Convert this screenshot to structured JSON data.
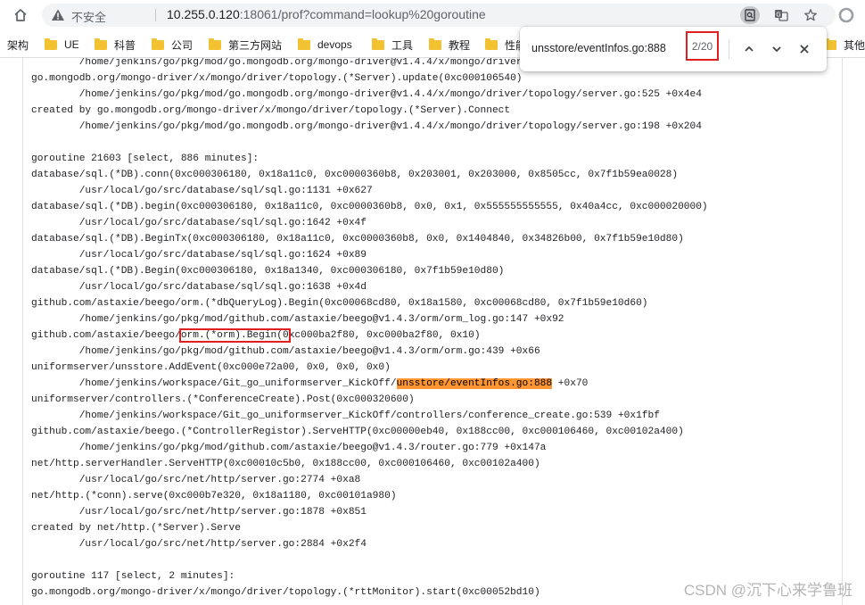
{
  "browser": {
    "insecure_label": "不安全",
    "url_host": "10.255.0.120",
    "url_rest": ":18061/prof?command=lookup%20goroutine",
    "icons": [
      "home-icon",
      "warning-icon",
      "find-in-page-icon",
      "translate-icon",
      "star-icon",
      "profile-icon"
    ]
  },
  "bookmarks": {
    "items": [
      "架构",
      "UE",
      "科普",
      "公司",
      "第三方网站",
      "devops",
      "工具",
      "教程",
      "性能"
    ],
    "other_label": "其他书"
  },
  "find": {
    "query": "unsstore/eventInfos.go:888",
    "count": "2/20"
  },
  "trace": {
    "l0": "        /home/jenkins/go/pkg/mod/go.mongodb.org/mongo-driver@v1.4.4/x/mongo/driver/topology/server.go:464 +0xe9",
    "l1": "go.mongodb.org/mongo-driver/x/mongo/driver/topology.(*Server).update(0xc000106540)",
    "l2": "        /home/jenkins/go/pkg/mod/go.mongodb.org/mongo-driver@v1.4.4/x/mongo/driver/topology/server.go:525 +0x4e4",
    "l3": "created by go.mongodb.org/mongo-driver/x/mongo/driver/topology.(*Server).Connect",
    "l4": "        /home/jenkins/go/pkg/mod/go.mongodb.org/mongo-driver@v1.4.4/x/mongo/driver/topology/server.go:198 +0x204",
    "l5": "",
    "l6": "goroutine 21603 [select, 886 minutes]:",
    "l7": "database/sql.(*DB).conn(0xc000306180, 0x18a11c0, 0xc0000360b8, 0x203001, 0x203000, 0x8505cc, 0x7f1b59ea0028)",
    "l8": "        /usr/local/go/src/database/sql/sql.go:1131 +0x627",
    "l9": "database/sql.(*DB).begin(0xc000306180, 0x18a11c0, 0xc0000360b8, 0x0, 0x1, 0x555555555555, 0x40a4cc, 0xc000020000)",
    "l10": "        /usr/local/go/src/database/sql/sql.go:1642 +0x4f",
    "l11": "database/sql.(*DB).BeginTx(0xc000306180, 0x18a11c0, 0xc0000360b8, 0x0, 0x1404840, 0x34826b00, 0x7f1b59e10d80)",
    "l12": "        /usr/local/go/src/database/sql/sql.go:1624 +0x89",
    "l13": "database/sql.(*DB).Begin(0xc000306180, 0x18a1340, 0xc000306180, 0x7f1b59e10d80)",
    "l14": "        /usr/local/go/src/database/sql/sql.go:1638 +0x4d",
    "l15": "github.com/astaxie/beego/orm.(*dbQueryLog).Begin(0xc00068cd80, 0x18a1580, 0xc00068cd80, 0x7f1b59e10d60)",
    "l16": "        /home/jenkins/go/pkg/mod/github.com/astaxie/beego@v1.4.3/orm/orm_log.go:147 +0x92",
    "l17_pre": "github.com/astaxie/beego/",
    "l17_box": "orm.(*orm).Begin(0",
    "l17_post": "xc000ba2f80, 0xc000ba2f80, 0x10)",
    "l18": "        /home/jenkins/go/pkg/mod/github.com/astaxie/beego@v1.4.3/orm/orm.go:439 +0x66",
    "l19": "uniformserver/unsstore.AddEvent(0xc000e72a00, 0x0, 0x0, 0x0)",
    "l20_pre": "        /home/jenkins/workspace/Git_go_uniformserver_KickOff/",
    "l20_hl": "unsstore/eventInfos.go:888",
    "l20_post": " +0x70",
    "l21": "uniformserver/controllers.(*ConferenceCreate).Post(0xc000320600)",
    "l22": "        /home/jenkins/workspace/Git_go_uniformserver_KickOff/controllers/conference_create.go:539 +0x1fbf",
    "l23": "github.com/astaxie/beego.(*ControllerRegistor).ServeHTTP(0xc00000eb40, 0x188cc00, 0xc000106460, 0xc00102a400)",
    "l24": "        /home/jenkins/go/pkg/mod/github.com/astaxie/beego@v1.4.3/router.go:779 +0x147a",
    "l25": "net/http.serverHandler.ServeHTTP(0xc00010c5b0, 0x188cc00, 0xc000106460, 0xc00102a400)",
    "l26": "        /usr/local/go/src/net/http/server.go:2774 +0xa8",
    "l27": "net/http.(*conn).serve(0xc000b7e320, 0x18a1180, 0xc00101a980)",
    "l28": "        /usr/local/go/src/net/http/server.go:1878 +0x851",
    "l29": "created by net/http.(*Server).Serve",
    "l30": "        /usr/local/go/src/net/http/server.go:2884 +0x2f4",
    "l31": "",
    "l32": "goroutine 117 [select, 2 minutes]:",
    "l33": "go.mongodb.org/mongo-driver/x/mongo/driver/topology.(*rttMonitor).start(0xc00052bd10)"
  },
  "watermark": "CSDN @沉下心来学鲁班",
  "colors": {
    "highlight": "#ff9632",
    "annotation_box": "#e02020",
    "folder": "#f2c232"
  }
}
